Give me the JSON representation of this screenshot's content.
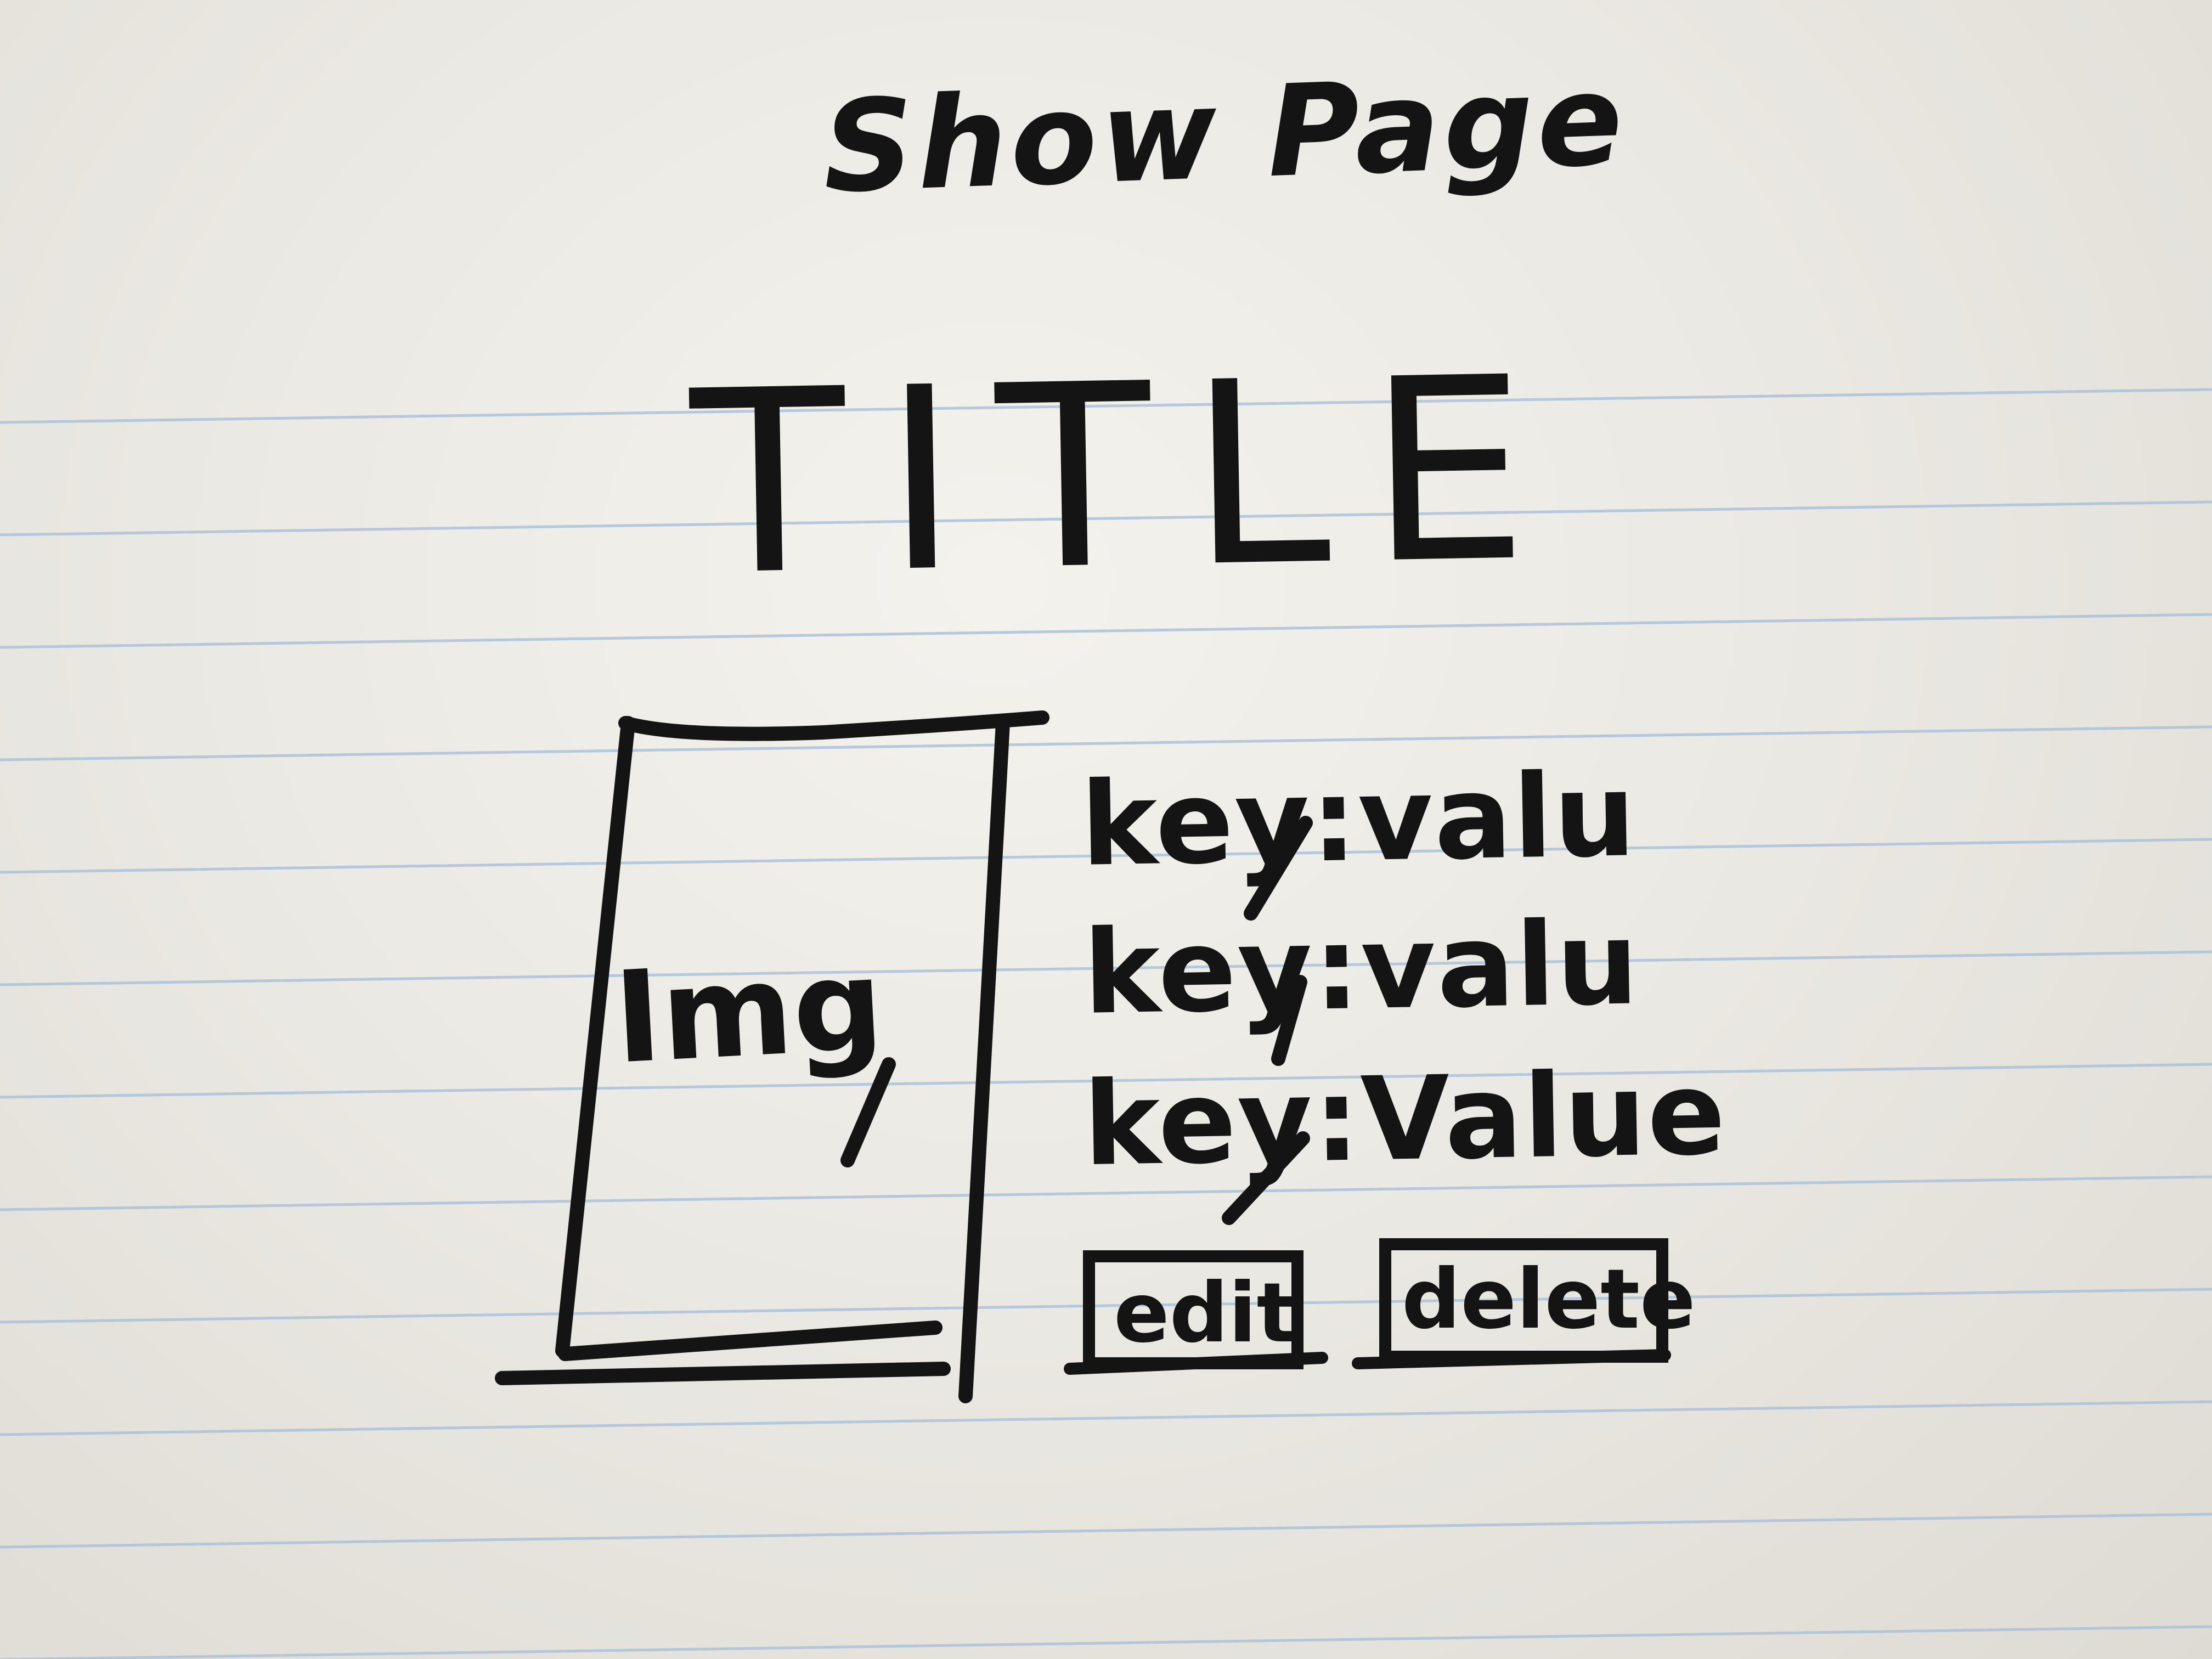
{
  "sketch": {
    "heading": "Show Page",
    "title": "TITLE",
    "image_placeholder": "Img",
    "fields": [
      {
        "text": "key:valu"
      },
      {
        "text": "key:valu"
      },
      {
        "text": "key:Value"
      }
    ],
    "buttons": {
      "edit": "edit",
      "delete": "delete"
    }
  },
  "colors": {
    "ink": "#141414",
    "paper": "#ebe9e3",
    "rule_lines": "#a9c2dc"
  }
}
